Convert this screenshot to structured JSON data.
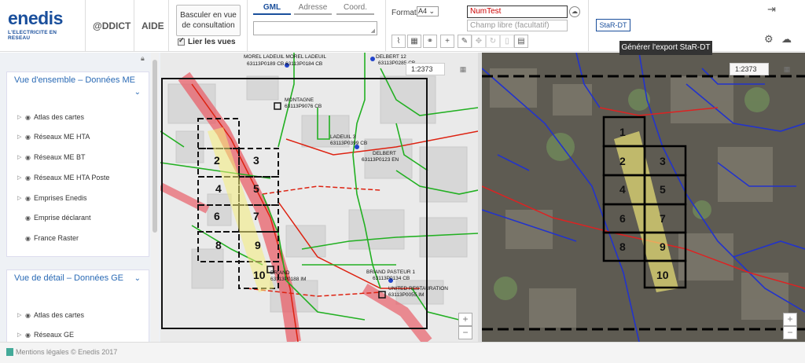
{
  "brand": {
    "name": "enedis",
    "tagline": "L'ELECTRICITE EN RESEAU"
  },
  "nav": {
    "ddict": "@DDICT",
    "aide": "AIDE"
  },
  "switch_view": {
    "label": "Basculer en vue de consultation"
  },
  "link_views": {
    "label": "Lier les vues",
    "checked": true
  },
  "tabs": [
    {
      "label": "GML",
      "active": true
    },
    {
      "label": "Adresse"
    },
    {
      "label": "Coord."
    }
  ],
  "export": {
    "format_label": "Format",
    "format_value": "A4",
    "name_value": "NumTest",
    "free_placeholder": "Champ libre (facultatif)",
    "stardt_label": "StaR-DT",
    "tooltip": "Générer l'export StaR-DT"
  },
  "panel": {
    "overview": {
      "title": "Vue d'ensemble – Données ME",
      "layers": [
        "Atlas des cartes",
        "Réseaux ME HTA",
        "Réseaux ME BT",
        "Réseaux ME HTA Poste",
        "Emprises Enedis",
        "Emprise déclarant",
        "France Raster"
      ]
    },
    "detail": {
      "title": "Vue de détail – Données GE",
      "layers": [
        "Atlas des cartes",
        "Réseaux GE"
      ]
    }
  },
  "map_left": {
    "scale": "1:2373",
    "labels": [
      "MOREL LADEUIL MOREL LADEUIL",
      "63113P0189 CB 63113P0184 CB",
      "DELBERT 12",
      "63113P0285 CB",
      "MONTAGNE",
      "63113P9076 CB",
      "LADEUIL 3",
      "63113P0399 CB",
      "DELBERT",
      "63113P0123 EN",
      "BRIAND",
      "63113P0188 IM",
      "BRIAND PASTEUR 1",
      "63113P0134 CB",
      "UNITED RESTAURATION",
      "63113P0055 IM"
    ],
    "tiles": [
      "2",
      "3",
      "4",
      "5",
      "6",
      "7",
      "8",
      "9",
      "10"
    ]
  },
  "map_right": {
    "scale": "1:2373",
    "tiles": [
      "1",
      "2",
      "3",
      "4",
      "5",
      "6",
      "7",
      "8",
      "9",
      "10"
    ]
  },
  "footer": {
    "text": "Mentions légales © Enedis 2017"
  }
}
